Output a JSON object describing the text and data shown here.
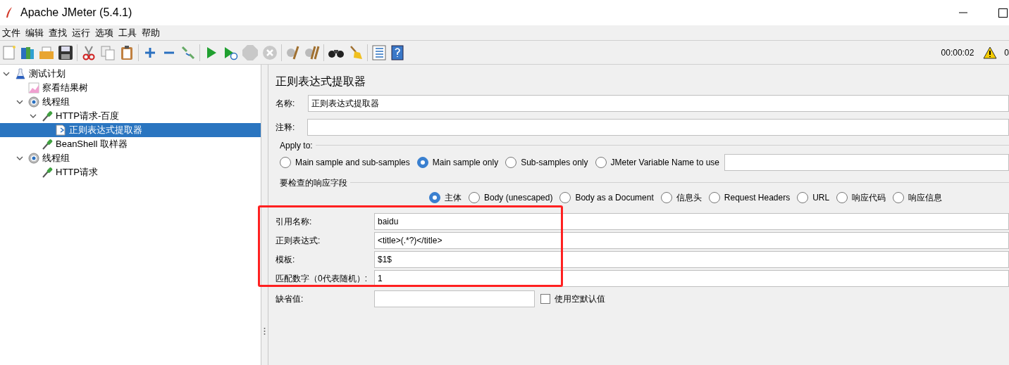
{
  "window": {
    "title": "Apache JMeter (5.4.1)"
  },
  "menu": [
    "文件",
    "编辑",
    "查找",
    "运行",
    "选项",
    "工具",
    "帮助"
  ],
  "toolbar_status": {
    "elapsed": "00:00:02",
    "warnings": "0"
  },
  "tree": [
    {
      "label": "测试计划",
      "kind": "plan",
      "expanded": true,
      "selected": false,
      "children": [
        {
          "label": "察看结果树",
          "kind": "listener",
          "selected": false
        },
        {
          "label": "线程组",
          "kind": "threads",
          "expanded": true,
          "selected": false,
          "children": [
            {
              "label": "HTTP请求-百度",
              "kind": "sampler",
              "expanded": true,
              "selected": false,
              "children": [
                {
                  "label": "正则表达式提取器",
                  "kind": "extractor",
                  "selected": true
                }
              ]
            },
            {
              "label": "BeanShell 取样器",
              "kind": "sampler",
              "selected": false
            }
          ]
        },
        {
          "label": "线程组",
          "kind": "threads",
          "expanded": true,
          "selected": false,
          "children": [
            {
              "label": "HTTP请求",
              "kind": "sampler",
              "selected": false
            }
          ]
        }
      ]
    }
  ],
  "panel": {
    "title": "正则表达式提取器",
    "name": {
      "label": "名称:",
      "value": "正则表达式提取器"
    },
    "comment": {
      "label": "注释:"
    },
    "apply_to": {
      "legend": "Apply to:",
      "options": [
        {
          "label": "Main sample and sub-samples",
          "selected": false
        },
        {
          "label": "Main sample only",
          "selected": true
        },
        {
          "label": "Sub-samples only",
          "selected": false
        },
        {
          "label": "JMeter Variable Name to use",
          "selected": false
        }
      ]
    },
    "field_to_check": {
      "legend": "要检查的响应字段",
      "options": [
        {
          "label": "主体",
          "selected": true
        },
        {
          "label": "Body (unescaped)",
          "selected": false
        },
        {
          "label": "Body as a Document",
          "selected": false
        },
        {
          "label": "信息头",
          "selected": false
        },
        {
          "label": "Request Headers",
          "selected": false
        },
        {
          "label": "URL",
          "selected": false
        },
        {
          "label": "响应代码",
          "selected": false
        },
        {
          "label": "响应信息",
          "selected": false
        }
      ]
    },
    "fields": [
      {
        "label": "引用名称:",
        "value": "baidu"
      },
      {
        "label": "正则表达式:",
        "value": "<title>(.*?)</title>"
      },
      {
        "label": "模板:",
        "value": "$1$"
      },
      {
        "label": "匹配数字（0代表随机）:",
        "value": "1"
      }
    ],
    "default": {
      "label": "缺省值:",
      "checkbox": {
        "label": "使用空默认值",
        "checked": false
      }
    }
  }
}
